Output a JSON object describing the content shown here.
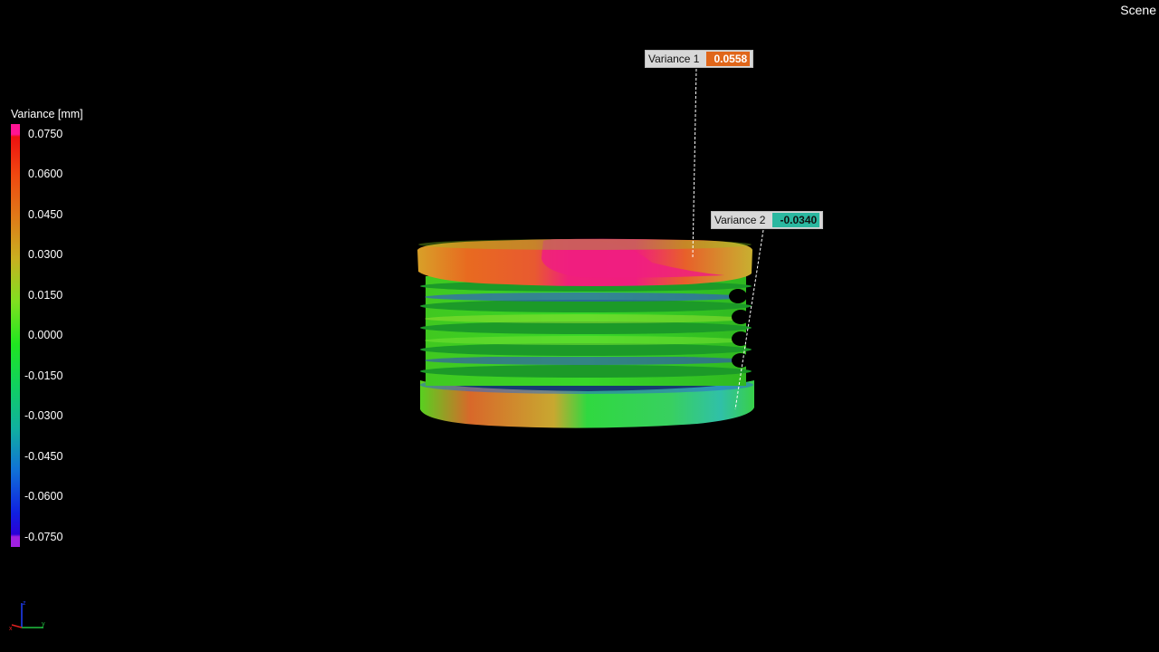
{
  "scene": {
    "label": "Scene"
  },
  "legend": {
    "title": "Variance [mm]",
    "ticks": [
      "0.0750",
      "0.0600",
      "0.0450",
      "0.0300",
      "0.0150",
      "0.0000",
      "-0.0150",
      "-0.0300",
      "-0.0450",
      "-0.0600",
      "-0.0750"
    ]
  },
  "callouts": {
    "v1": {
      "label": "Variance 1",
      "value": "0.0558",
      "color": "#e0661a"
    },
    "v2": {
      "label": "Variance 2",
      "value": "-0.0340",
      "color": "#2bb8a0"
    }
  },
  "colors": {
    "background": "#000000",
    "max": "#ff1493",
    "min": "#a020e0"
  },
  "icons": {
    "axis": "xyz-axis-triad-icon"
  }
}
